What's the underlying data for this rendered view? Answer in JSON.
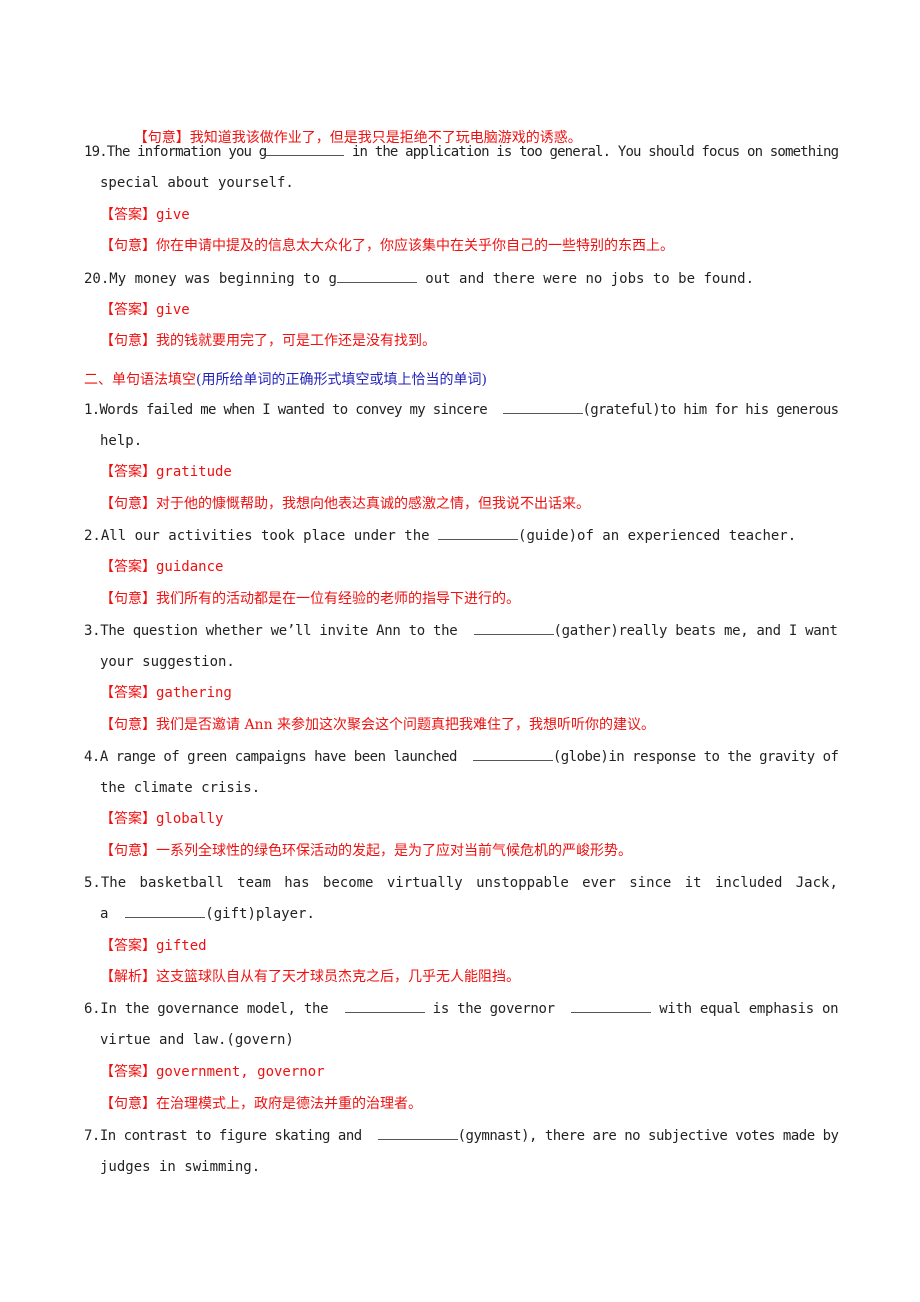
{
  "prev_item": {
    "meaning_tag": "【句意】",
    "meaning": "我知道我该做作业了，但是我只是拒绝不了玩电脑游戏的诱惑。"
  },
  "items_part1": [
    {
      "number": "19.",
      "text_before": "The information you g",
      "text_after": " in the application is too general. You should focus on something",
      "continuation": "special about yourself.",
      "answer_tag": "【答案】",
      "answer": "give",
      "meaning_tag": "【句意】",
      "meaning": "你在申请中提及的信息太大众化了，你应该集中在关乎你自己的一些特别的东西上。"
    },
    {
      "number": "20.",
      "text_before": "My money was beginning to g",
      "text_after": " out and there were no jobs to be found.",
      "answer_tag": "【答案】",
      "answer": "give",
      "meaning_tag": "【句意】",
      "meaning": "我的钱就要用完了，可是工作还是没有找到。"
    }
  ],
  "section2": {
    "title_red": "二、单句语法填空",
    "title_blue": "(用所给单词的正确形式填空或填上恰当的单词)"
  },
  "items_part2": [
    {
      "number": "1.",
      "text_before": "Words failed me when I wanted to convey my sincere  ",
      "text_after": "(grateful)to him for his generous",
      "continuation": "help.",
      "answer_tag": "【答案】",
      "answer": "gratitude",
      "meaning_tag": "【句意】",
      "meaning": "对于他的慷慨帮助，我想向他表达真诚的感激之情，但我说不出话来。"
    },
    {
      "number": "2.",
      "text_before": "All our activities took place under the ",
      "text_after": "(guide)of an experienced teacher.",
      "answer_tag": "【答案】",
      "answer": "guidance",
      "meaning_tag": "【句意】",
      "meaning": "我们所有的活动都是在一位有经验的老师的指导下进行的。"
    },
    {
      "number": "3.",
      "text_before": "The question whether we’ll invite Ann to the  ",
      "text_after": "(gather)really beats me, and I want",
      "continuation": "your suggestion.",
      "answer_tag": "【答案】",
      "answer": "gathering",
      "meaning_tag": "【句意】",
      "meaning": "我们是否邀请 Ann 来参加这次聚会这个问题真把我难住了，我想听听你的建议。"
    },
    {
      "number": "4.",
      "text_before": "A range of green campaigns have been launched  ",
      "text_after": "(globe)in response to the gravity of",
      "continuation": "the climate crisis.",
      "answer_tag": "【答案】",
      "answer": "globally",
      "meaning_tag": "【句意】",
      "meaning": "一系列全球性的绿色环保活动的发起，是为了应对当前气候危机的严峻形势。"
    },
    {
      "number": "5.",
      "words": [
        "5.The",
        "basketball",
        "team",
        "has",
        "become",
        "virtually",
        "unstoppable",
        "ever",
        "since",
        "it",
        "included",
        "Jack,"
      ],
      "continuation_before": "a  ",
      "continuation_after": "(gift)player.",
      "answer_tag": "【答案】",
      "answer": "gifted",
      "meaning_tag": "【解析】",
      "meaning": "这支篮球队自从有了天才球员杰克之后，几乎无人能阻挡。"
    },
    {
      "number": "6.",
      "text_before": "In the governance model, the  ",
      "text_middle": " is the governor  ",
      "text_after": " with equal emphasis on",
      "continuation": "virtue and law.(govern)",
      "answer_tag": "【答案】",
      "answer": "government, governor",
      "meaning_tag": "【句意】",
      "meaning": "在治理模式上，政府是德法并重的治理者。"
    },
    {
      "number": "7.",
      "text_before": "In contrast to figure skating and  ",
      "text_after": "(gymnast), there are no subjective votes made by",
      "continuation": "judges in swimming."
    }
  ]
}
